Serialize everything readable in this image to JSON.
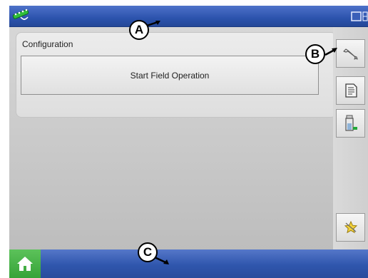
{
  "callouts": {
    "a": "A",
    "b": "B",
    "c": "C"
  },
  "config_panel": {
    "title": "Configuration",
    "start_button_label": "Start Field Operation"
  },
  "icons": {
    "gps": "gps-satellite-icon",
    "display": "display-icon",
    "tools": "wrench-icon",
    "summary": "report-icon",
    "product": "product-level-icon",
    "favorites": "star-icon",
    "home": "home-icon"
  },
  "colors": {
    "topbar": "#2c53ad",
    "bottombar": "#2f56ad",
    "home": "#36a338",
    "background": "#c9c9c9"
  }
}
